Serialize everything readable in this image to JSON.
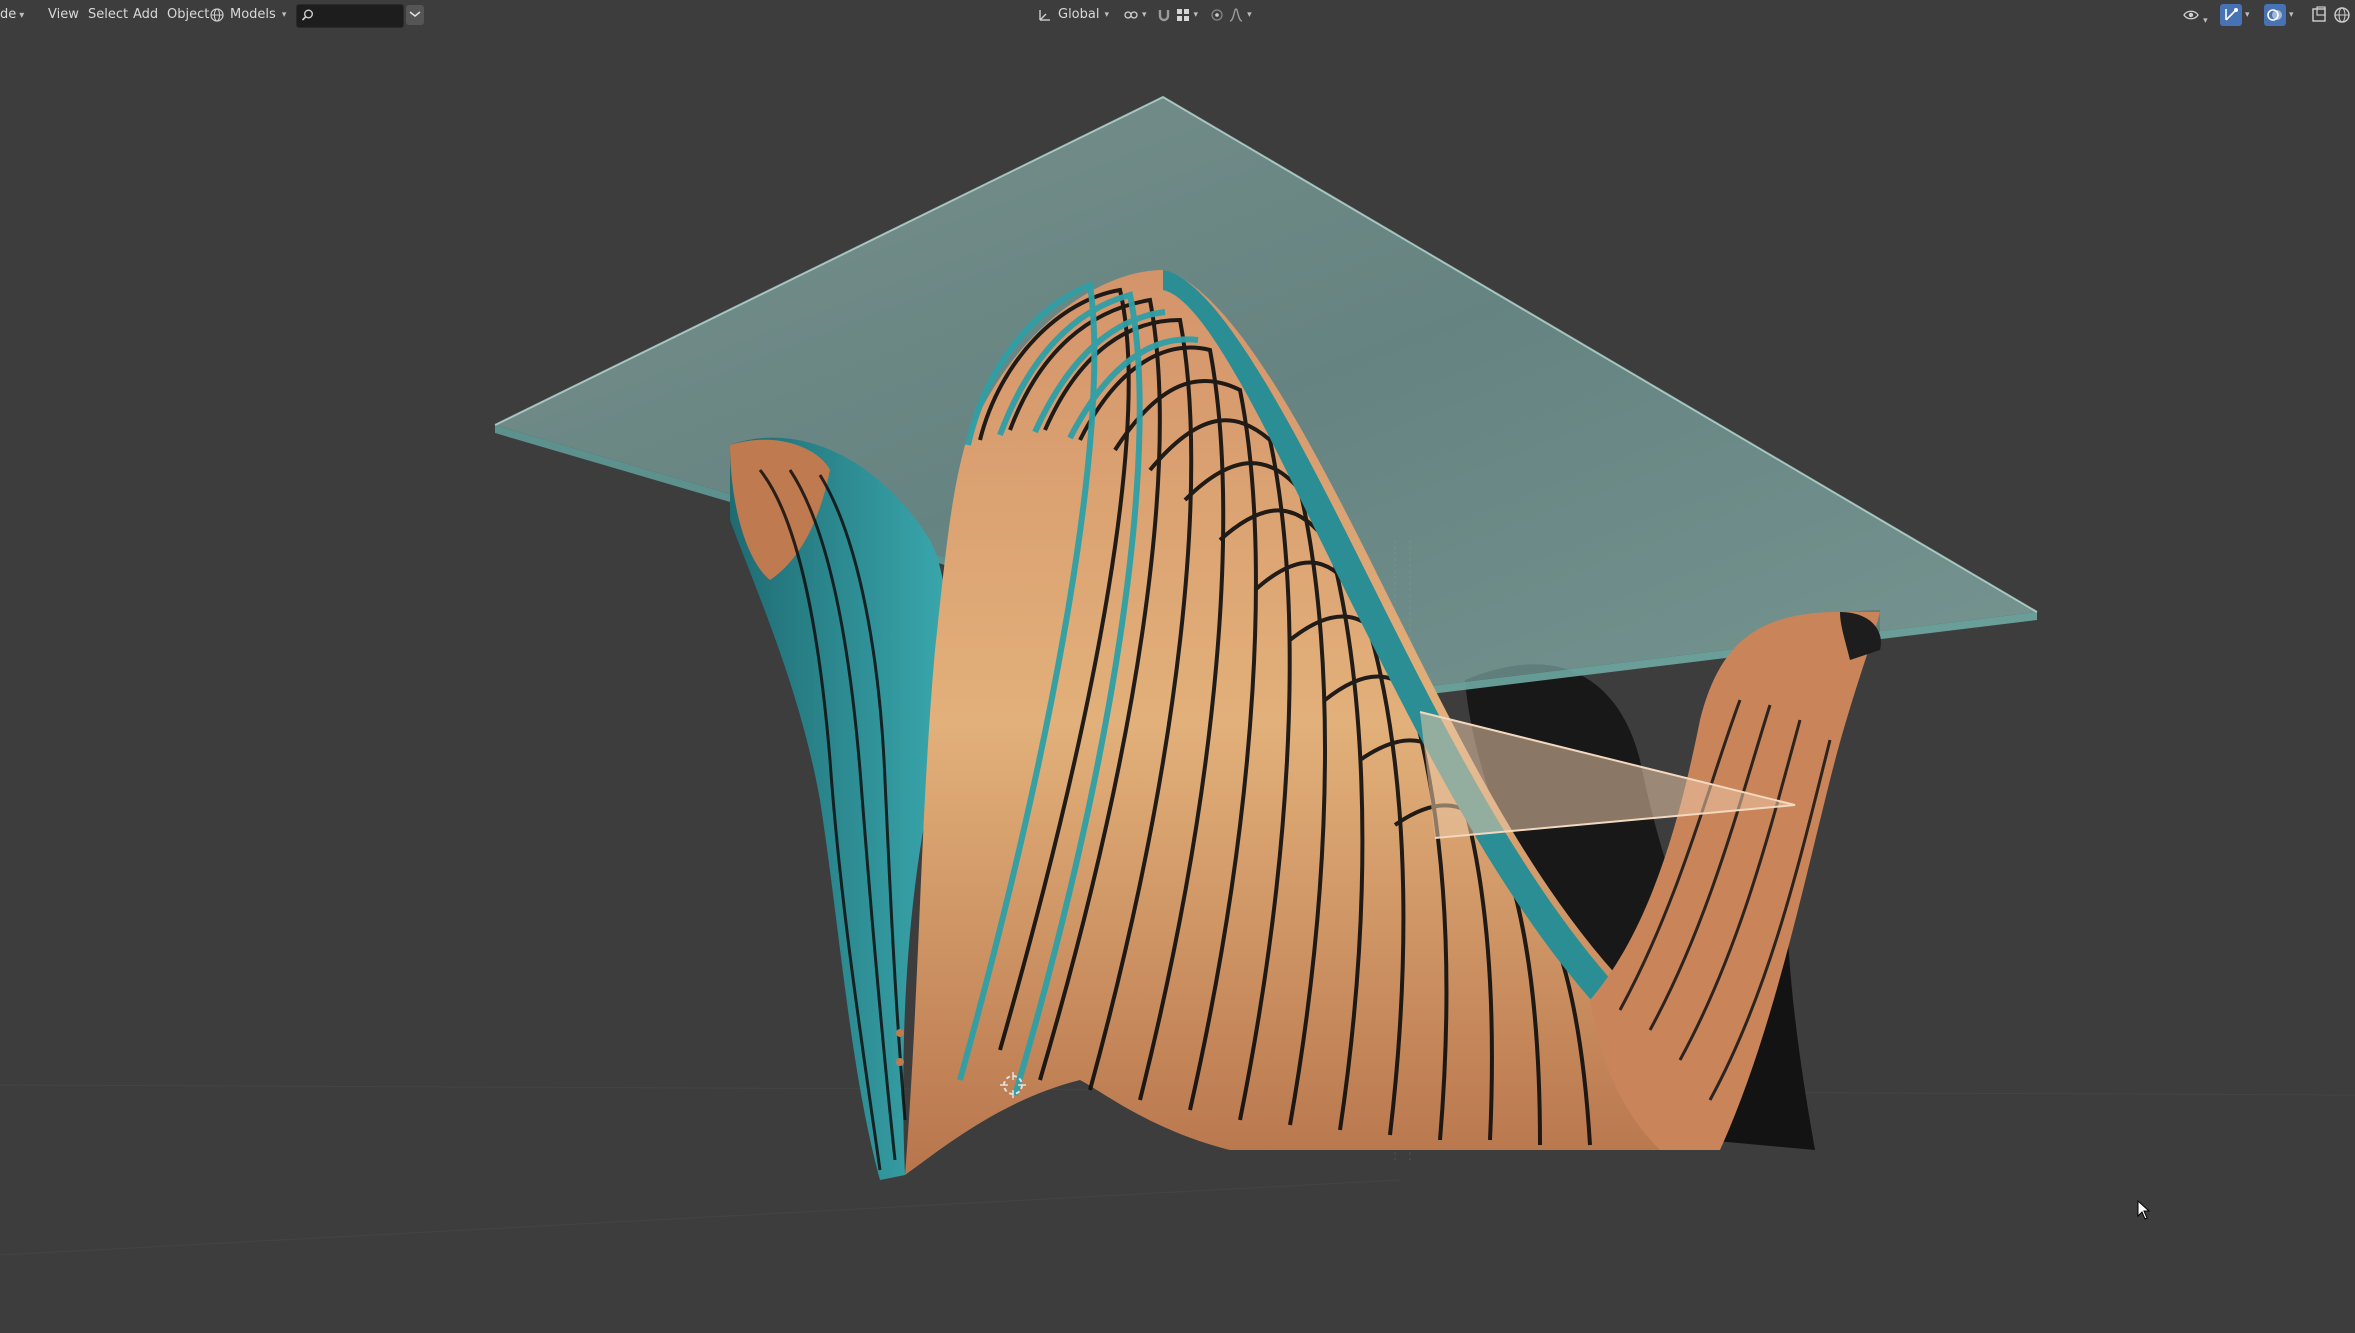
{
  "header": {
    "mode_label_partial": "de",
    "menus": {
      "view": "View",
      "select": "Select",
      "add": "Add",
      "object": "Object"
    },
    "collection_label": "Models",
    "search_value": "",
    "transform_orientation": "Global"
  },
  "icons": {
    "collection": "globe-icon",
    "search": "search-icon",
    "filter": "filter-icon",
    "orientation": "transform-orientation-icon",
    "pivot": "pivot-point-icon",
    "snap": "snap-magnet-icon",
    "snap_target": "snap-grid-icon",
    "proportional": "proportional-editing-icon",
    "falloff": "falloff-curve-icon",
    "visibility": "eye-icon",
    "gizmo": "gizmo-icon",
    "overlay": "overlay-icon",
    "xray": "xray-icon",
    "shading": "shading-solid-icon",
    "cursor": "mouse-cursor-icon",
    "3d_cursor": "3d-cursor-icon"
  },
  "colors": {
    "viewport_bg": "#3d3d3d",
    "glass": "#7fb6b2",
    "copper": "#c98a5c",
    "teal": "#2a8a90",
    "accent": "#4772b3"
  }
}
